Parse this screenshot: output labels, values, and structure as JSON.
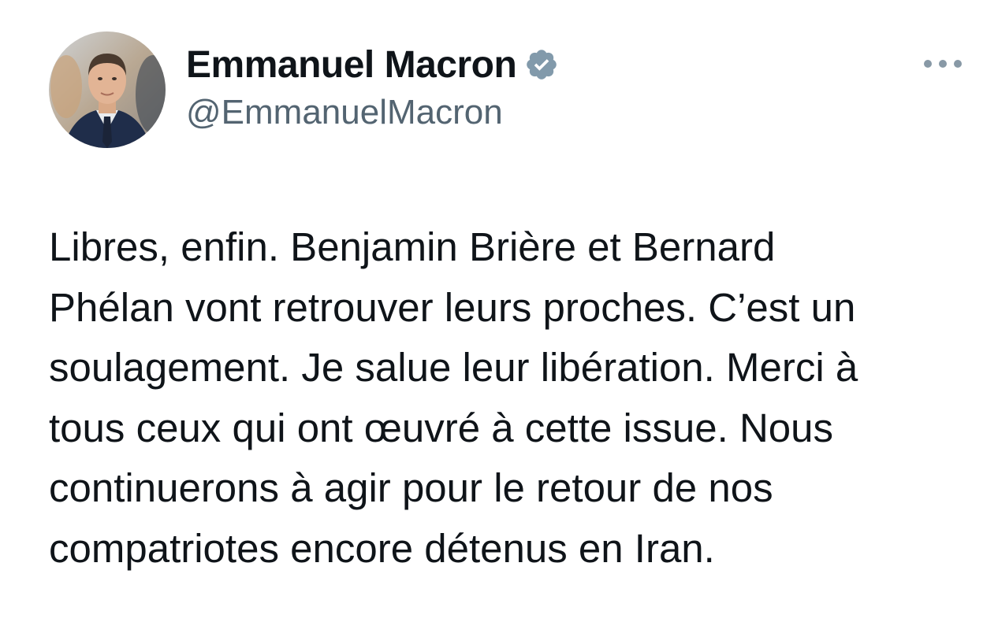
{
  "author": {
    "display_name": "Emmanuel Macron",
    "handle": "@EmmanuelMacron",
    "verified_icon": "verified-badge-icon",
    "verified_color": "#829aab"
  },
  "header": {
    "more_icon": "more-options-icon"
  },
  "tweet": {
    "lines": [
      "Libres, enfin. Benjamin Brière et Bernard",
      "Phélan vont retrouver leurs proches. C’est un",
      "soulagement. Je salue leur libération. Merci à",
      "tous ceux qui ont œuvré à cette issue. Nous",
      "continuerons à agir pour le retour de nos",
      "compatriotes encore détenus en Iran."
    ]
  },
  "colors": {
    "text_primary": "#0f1419",
    "text_secondary": "#536471",
    "background": "#ffffff"
  }
}
